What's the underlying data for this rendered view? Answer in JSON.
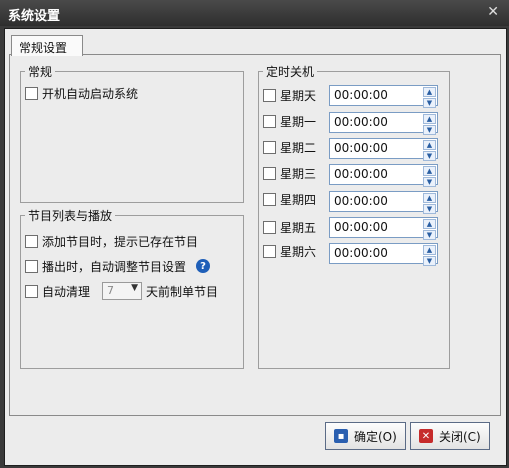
{
  "window": {
    "title": "系统设置",
    "close_icon": "close-icon"
  },
  "tabs": [
    {
      "label": "常规设置"
    }
  ],
  "general": {
    "legend": "常规",
    "autostart_label": "开机自动启动系统"
  },
  "playlist": {
    "legend": "节目列表与播放",
    "items": [
      {
        "label": "添加节目时，提示已存在节目"
      },
      {
        "label": "播出时，自动调整节目设置"
      }
    ],
    "autoclean_label": "自动清理",
    "autoclean_days": "7",
    "autoclean_suffix": "天前制单节目"
  },
  "shutdown": {
    "legend": "定时关机",
    "days": [
      {
        "label": "星期天",
        "time": "00:00:00"
      },
      {
        "label": "星期一",
        "time": "00:00:00"
      },
      {
        "label": "星期二",
        "time": "00:00:00"
      },
      {
        "label": "星期三",
        "time": "00:00:00"
      },
      {
        "label": "星期四",
        "time": "00:00:00"
      },
      {
        "label": "星期五",
        "time": "00:00:00"
      },
      {
        "label": "星期六",
        "time": "00:00:00"
      }
    ]
  },
  "buttons": {
    "ok_label": "确定(O)",
    "cancel_label": "关闭(C)"
  },
  "colors": {
    "title_bar": "#333333",
    "panel": "#ececec",
    "accent": "#1f5fb8"
  }
}
